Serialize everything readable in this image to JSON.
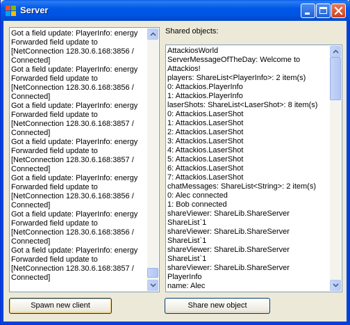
{
  "window": {
    "title": "Server",
    "icon": "app-window-icon",
    "controls": [
      "minimize-icon",
      "maximize-icon",
      "close-icon"
    ]
  },
  "log": {
    "text": "Got a field update: PlayerInfo: energy\nForwarded field update to\n[NetConnection 128.30.6.168:3856 /\nConnected]\nGot a field update: PlayerInfo: energy\nForwarded field update to\n[NetConnection 128.30.6.168:3856 /\nConnected]\nGot a field update: PlayerInfo: energy\nForwarded field update to\n[NetConnection 128.30.6.168:3857 /\nConnected]\nGot a field update: PlayerInfo: energy\nForwarded field update to\n[NetConnection 128.30.6.168:3857 /\nConnected]\nGot a field update: PlayerInfo: energy\nForwarded field update to\n[NetConnection 128.30.6.168:3856 /\nConnected]\nGot a field update: PlayerInfo: energy\nForwarded field update to\n[NetConnection 128.30.6.168:3856 /\nConnected]\nGot a field update: PlayerInfo: energy\nForwarded field update to\n[NetConnection 128.30.6.168:3857 /\nConnected]"
  },
  "shared": {
    "label": "Shared objects:",
    "text": "AttackiosWorld\nServerMessageOfTheDay: Welcome to\nAttackios!\nplayers: ShareList<PlayerInfo>: 2 item(s)\n0: Attackios.PlayerInfo\n1: Attackios.PlayerInfo\nlaserShots: ShareList<LaserShot>: 8 item(s)\n0: Attackios.LaserShot\n1: Attackios.LaserShot\n2: Attackios.LaserShot\n3: Attackios.LaserShot\n4: Attackios.LaserShot\n5: Attackios.LaserShot\n6: Attackios.LaserShot\n7: Attackios.LaserShot\nchatMessages: ShareList<String>: 2 item(s)\n0: Alec connected\n1: Bob connected\nshareViewer: ShareLib.ShareServer\nShareList`1\nshareViewer: ShareLib.ShareServer\nShareList`1\nshareViewer: ShareLib.ShareServer\nShareList`1\nshareViewer: ShareLib.ShareServer\nPlayerInfo\nname: Alec\nready: False"
  },
  "buttons": {
    "spawn": "Spawn new client",
    "share": "Share new object"
  }
}
